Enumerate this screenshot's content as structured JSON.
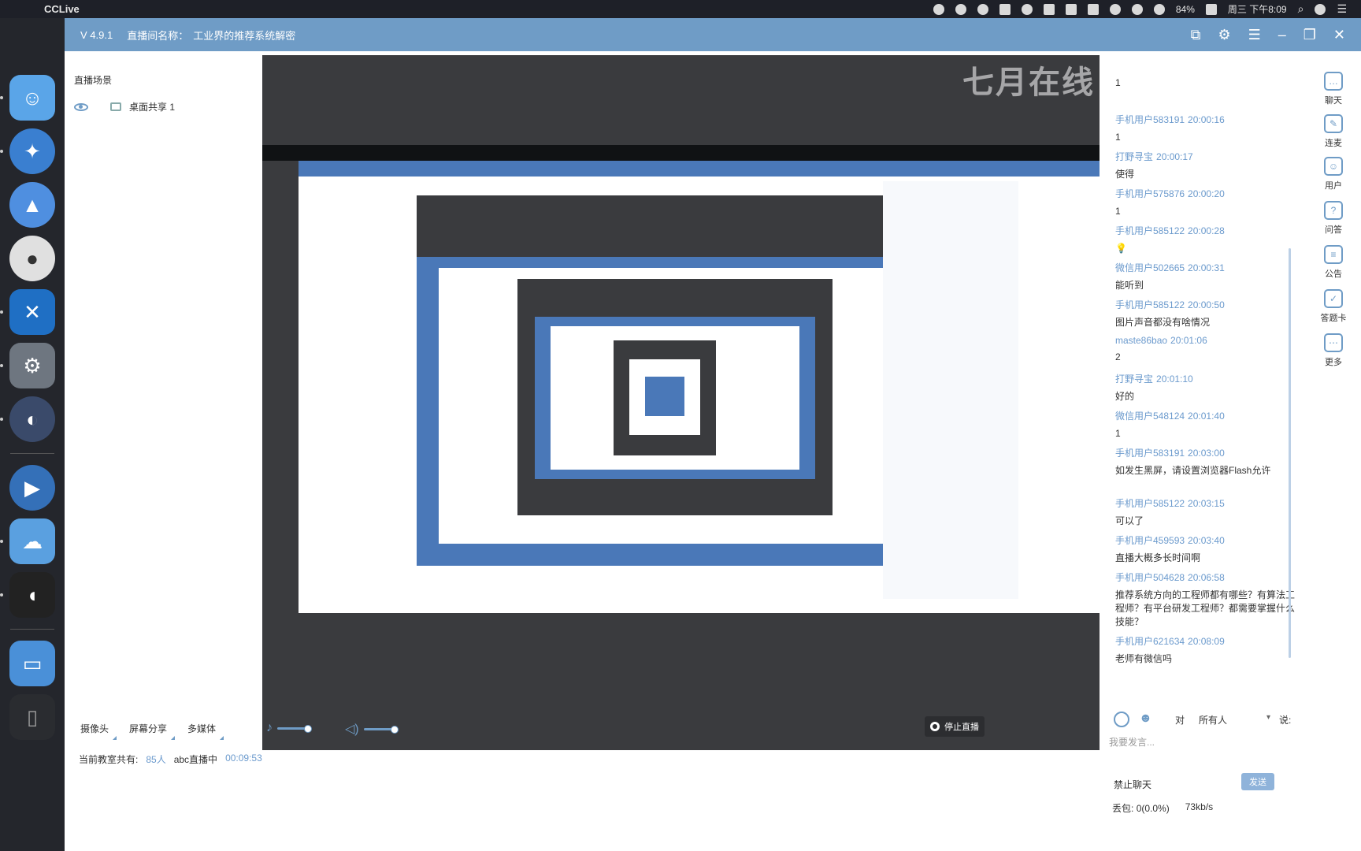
{
  "menubar": {
    "app_name": "CCLive",
    "battery": "84%",
    "clock": "周三 下午8:09"
  },
  "window": {
    "version": "V 4.9.1",
    "room_label": "直播间名称：",
    "room_name": "工业界的推荐系统解密"
  },
  "scenes": {
    "header": "直播场景",
    "items": [
      {
        "label": "桌面共享 1"
      }
    ]
  },
  "preview": {
    "watermark": "七月在线"
  },
  "chat": {
    "messages": [
      {
        "name": "手机用户583191",
        "time": "20:00:16",
        "text": "1"
      },
      {
        "name": "打野寻宝",
        "time": "20:00:17",
        "text": "使得"
      },
      {
        "name": "手机用户575876",
        "time": "20:00:20",
        "text": "1"
      },
      {
        "name": "手机用户585122",
        "time": "20:00:28",
        "text": "💡"
      },
      {
        "name": "微信用户502665",
        "time": "20:00:31",
        "text": "能听到"
      },
      {
        "name": "手机用户585122",
        "time": "20:00:50",
        "text": "图片声音都没有啥情况"
      },
      {
        "name": "maste86bao",
        "time": "20:01:06",
        "text": "2"
      },
      {
        "name": "打野寻宝",
        "time": "20:01:10",
        "text": "好的"
      },
      {
        "name": "微信用户548124",
        "time": "20:01:40",
        "text": "1"
      },
      {
        "name": "手机用户583191",
        "time": "20:03:00",
        "text": "如发生黑屏，请设置浏览器Flash允许"
      },
      {
        "name": "手机用户585122",
        "time": "20:03:15",
        "text": "可以了"
      },
      {
        "name": "手机用户459593",
        "time": "20:03:40",
        "text": "直播大概多长时间啊"
      },
      {
        "name": "手机用户504628",
        "time": "20:06:58",
        "text": "推荐系统方向的工程师都有哪些？有算法工程师？有平台研发工程师？都需要掌握什么技能？"
      },
      {
        "name": "手机用户621634",
        "time": "20:08:09",
        "text": "老师有微信吗"
      }
    ],
    "to_label": "对",
    "target": "所有人",
    "say_label": "说:",
    "input_placeholder": "我要发言...",
    "ban_label": "禁止聊天",
    "send_label": "发送",
    "packet_loss_label": "丢包:",
    "packet_loss": "0(0.0%)",
    "bitrate": "73kb/s"
  },
  "sidebar": {
    "items": [
      {
        "label": "聊天",
        "icon": "chat-icon"
      },
      {
        "label": "连麦",
        "icon": "mic-link-icon"
      },
      {
        "label": "用户",
        "icon": "user-icon"
      },
      {
        "label": "问答",
        "icon": "qa-icon"
      },
      {
        "label": "公告",
        "icon": "announcement-icon"
      },
      {
        "label": "答题卡",
        "icon": "answer-card-icon"
      },
      {
        "label": "更多",
        "icon": "more-icon"
      }
    ]
  },
  "toolbar": {
    "camera": "摄像头",
    "screen_share": "屏幕分享",
    "multimedia": "多媒体",
    "stop_live": "停止直播"
  },
  "status": {
    "viewers_label": "当前教室共有:",
    "viewers": "85人",
    "live_label": "abc直播中",
    "elapsed": "00:09:53"
  }
}
